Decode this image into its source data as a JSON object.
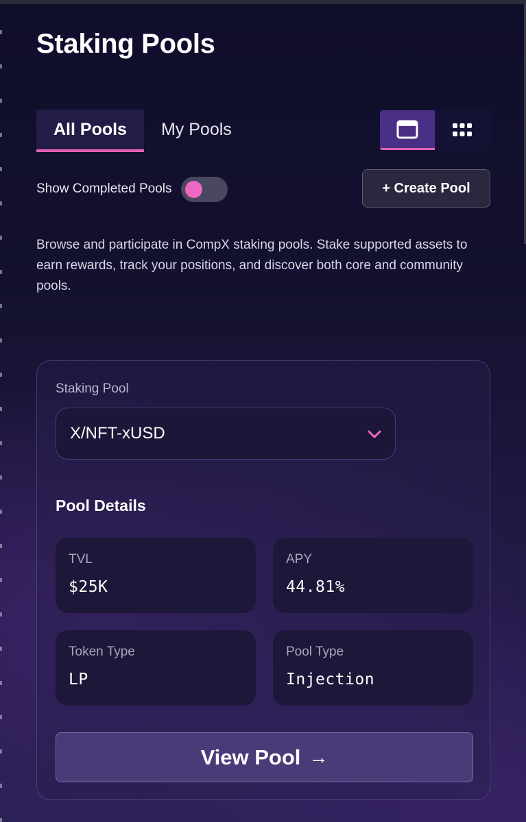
{
  "header": {
    "title": "Staking Pools"
  },
  "tabs": [
    {
      "label": "All Pools",
      "active": true
    },
    {
      "label": "My Pools",
      "active": false
    }
  ],
  "view_toggle": {
    "options": [
      {
        "icon": "card-view-icon",
        "active": true
      },
      {
        "icon": "grid-view-icon",
        "active": false
      }
    ]
  },
  "filters": {
    "show_completed_label": "Show Completed Pools",
    "show_completed_on": false
  },
  "actions": {
    "create_pool_label": "+ Create Pool"
  },
  "description": "Browse and participate in CompX staking pools. Stake supported assets to earn rewards, track your positions, and discover both core and community pools.",
  "pool_card": {
    "select_label": "Staking Pool",
    "selected_pool": "X/NFT-xUSD",
    "details_title": "Pool Details",
    "stats": [
      {
        "label": "TVL",
        "value": "$25K"
      },
      {
        "label": "APY",
        "value": "44.81%"
      },
      {
        "label": "Token Type",
        "value": "LP"
      },
      {
        "label": "Pool Type",
        "value": "Injection"
      }
    ],
    "view_button_label": "View Pool",
    "view_button_arrow": "→"
  },
  "colors": {
    "accent_pink": "#e463b5",
    "accent_purple": "#4a2f86",
    "background": "#0f0e2b"
  }
}
